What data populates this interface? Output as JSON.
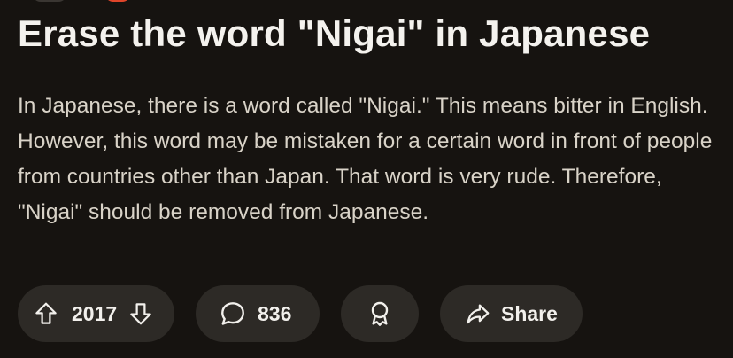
{
  "post": {
    "title": "Erase the word \"Nigai\" in Japanese",
    "body": "In Japanese, there is a word called \"Nigai.\" This means bitter in English. However, this word may be mistaken for a certain word in front of people from countries other than Japan. That word is very rude. Therefore, \"Nigai\" should be removed from Japanese."
  },
  "actions": {
    "vote_count": "2017",
    "comment_count": "836",
    "share_label": "Share"
  },
  "icons": {
    "upvote": "arrow-up-icon",
    "downvote": "arrow-down-icon",
    "comment": "speech-bubble-icon",
    "award": "award-ribbon-icon",
    "share": "share-arrow-icon"
  },
  "colors": {
    "background": "#161310",
    "pill": "#2d2a26",
    "title": "#f4f2ee",
    "body_text": "#d9d3c8",
    "badge": "#e0452a"
  }
}
